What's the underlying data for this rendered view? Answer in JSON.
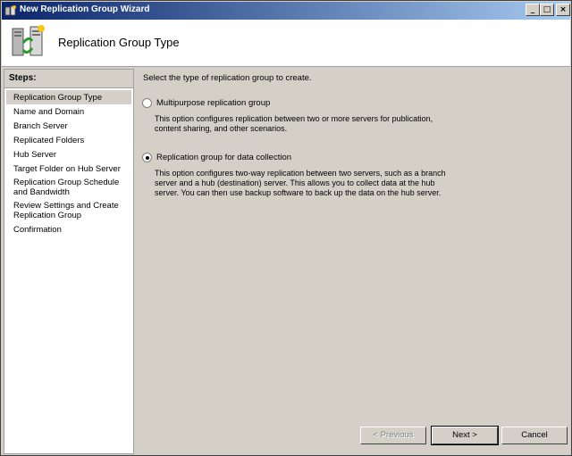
{
  "window": {
    "title": "New Replication Group Wizard"
  },
  "titlebar_buttons": {
    "minimize": "_",
    "maximize": "□",
    "close": "×"
  },
  "header": {
    "title": "Replication Group Type"
  },
  "steps": {
    "heading": "Steps:",
    "items": [
      {
        "label": "Replication Group Type",
        "active": true
      },
      {
        "label": "Name and Domain"
      },
      {
        "label": "Branch Server"
      },
      {
        "label": "Replicated Folders"
      },
      {
        "label": "Hub Server"
      },
      {
        "label": "Target Folder on Hub Server"
      },
      {
        "label": "Replication Group Schedule and Bandwidth"
      },
      {
        "label": "Review Settings and Create Replication Group"
      },
      {
        "label": "Confirmation"
      }
    ]
  },
  "main": {
    "prompt": "Select the type of replication group to create.",
    "options": [
      {
        "label": "Multipurpose replication group",
        "description": "This option configures replication between two or more servers for publication, content sharing, and other scenarios.",
        "selected": false
      },
      {
        "label": "Replication group for data collection",
        "description": "This option configures two-way replication between two servers, such as a branch server and a hub (destination) server. This allows you to collect data at the hub server. You can then use backup software to back up the data on the hub server.",
        "selected": true
      }
    ]
  },
  "buttons": {
    "previous": "< Previous",
    "next": "Next >",
    "cancel": "Cancel"
  }
}
